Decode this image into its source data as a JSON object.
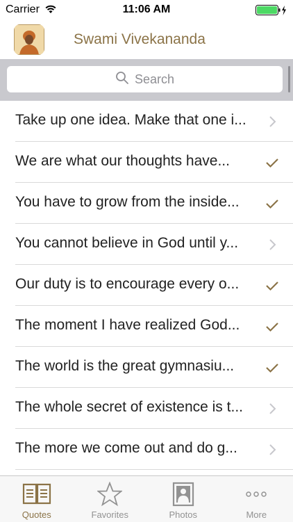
{
  "status_bar": {
    "carrier": "Carrier",
    "time": "11:06 AM"
  },
  "nav": {
    "title": "Swami Vivekananda"
  },
  "search": {
    "placeholder": "Search"
  },
  "quotes": [
    {
      "text": "Take up one idea. Make that one i...",
      "accessory": "chevron"
    },
    {
      "text": "We are what our thoughts have...",
      "accessory": "checkmark"
    },
    {
      "text": "You have to grow from the inside...",
      "accessory": "checkmark"
    },
    {
      "text": "You cannot believe in God until y...",
      "accessory": "chevron"
    },
    {
      "text": "Our duty is to encourage every o...",
      "accessory": "checkmark"
    },
    {
      "text": "The moment I have realized God...",
      "accessory": "checkmark"
    },
    {
      "text": "The world is the great gymnasiu...",
      "accessory": "checkmark"
    },
    {
      "text": "The whole secret of existence is t...",
      "accessory": "chevron"
    },
    {
      "text": "The more we come out and do g...",
      "accessory": "chevron"
    }
  ],
  "tabs": [
    {
      "label": "Quotes",
      "icon": "book-icon",
      "active": true
    },
    {
      "label": "Favorites",
      "icon": "star-icon",
      "active": false
    },
    {
      "label": "Photos",
      "icon": "photo-icon",
      "active": false
    },
    {
      "label": "More",
      "icon": "more-icon",
      "active": false
    }
  ],
  "colors": {
    "accent": "#8b7347",
    "battery": "#4cd964",
    "separator": "#d9d9d9",
    "search_band": "#c9c9ce"
  }
}
